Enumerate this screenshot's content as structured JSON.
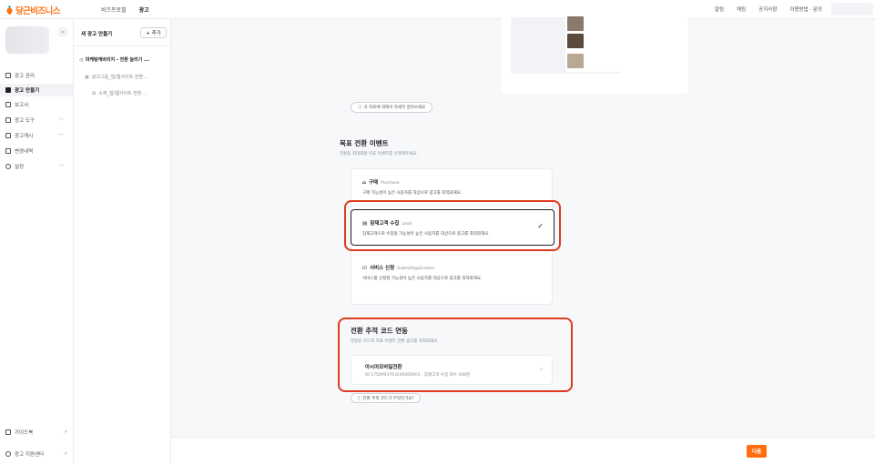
{
  "brand": {
    "name": "당근비즈니스",
    "accent": "#ff6f0f"
  },
  "topnav": {
    "items": [
      {
        "label": "비즈프로필"
      },
      {
        "label": "광고"
      }
    ]
  },
  "topright": {
    "items": [
      {
        "label": "알림"
      },
      {
        "label": "채팅"
      },
      {
        "label": "공지사항"
      },
      {
        "label": "이용방법 · 문의"
      }
    ]
  },
  "sidebar": {
    "items": [
      {
        "label": "광고 관리",
        "icon": "megaphone-icon"
      },
      {
        "label": "광고 만들기",
        "icon": "create-icon"
      },
      {
        "label": "보고서",
        "icon": "report-icon"
      },
      {
        "label": "광고 도구",
        "icon": "tool-icon"
      },
      {
        "label": "광고캐시",
        "icon": "cash-icon"
      },
      {
        "label": "변경내역",
        "icon": "history-icon"
      },
      {
        "label": "설정",
        "icon": "gear-icon"
      }
    ],
    "bottom": [
      {
        "label": "가이드북",
        "icon": "book-icon"
      },
      {
        "label": "광고 지원센터",
        "icon": "support-icon"
      }
    ]
  },
  "tree": {
    "header": "새 광고 만들기",
    "add_label": "+ 추가",
    "campaign": "마케팅캐버리지 - 전환 늘리기 ...",
    "group": "광고그룹_앱/웹사이트 전환 ...",
    "material": "소재_앱/웹사이트 전환 ..."
  },
  "main": {
    "learn_more": "각 목표에 대해서 자세히 알아보세요",
    "goal_section": {
      "title": "목표 전환 이벤트",
      "subtitle": "전환을 최대화할 목표 이벤트를 선택해주세요.",
      "events": [
        {
          "title": "구매",
          "en": "Purchase",
          "desc": "구매 가능성이 높은 사용자를 대상으로 광고를 최적화해요.",
          "icon": "cart-icon",
          "selected": false
        },
        {
          "title": "잠재고객 수집",
          "en": "Lead",
          "desc": "잠재고객으로 수집될 가능성이 높은 사용자를 대상으로 광고를 최적화해요.",
          "icon": "lead-icon",
          "selected": true
        },
        {
          "title": "서비스 신청",
          "en": "SubmitApplication",
          "desc": "서비스를 신청할 가능성이 높은 사용자를 대상으로 광고를 최적화해요.",
          "icon": "checklist-icon",
          "selected": false
        }
      ]
    },
    "tracking_section": {
      "title": "전환 추적 코드 연동",
      "subtitle": "연동된 코드로 목표 이벤트 전환 광고를 최적화해요.",
      "card_name": "아시아모바일전환",
      "card_meta": "ID 1750993763249200001 · 잠재고객 수집 회수 248명",
      "help": "전환 추적 코드가 무엇인가요?"
    }
  },
  "footer": {
    "next_label": "다음"
  }
}
